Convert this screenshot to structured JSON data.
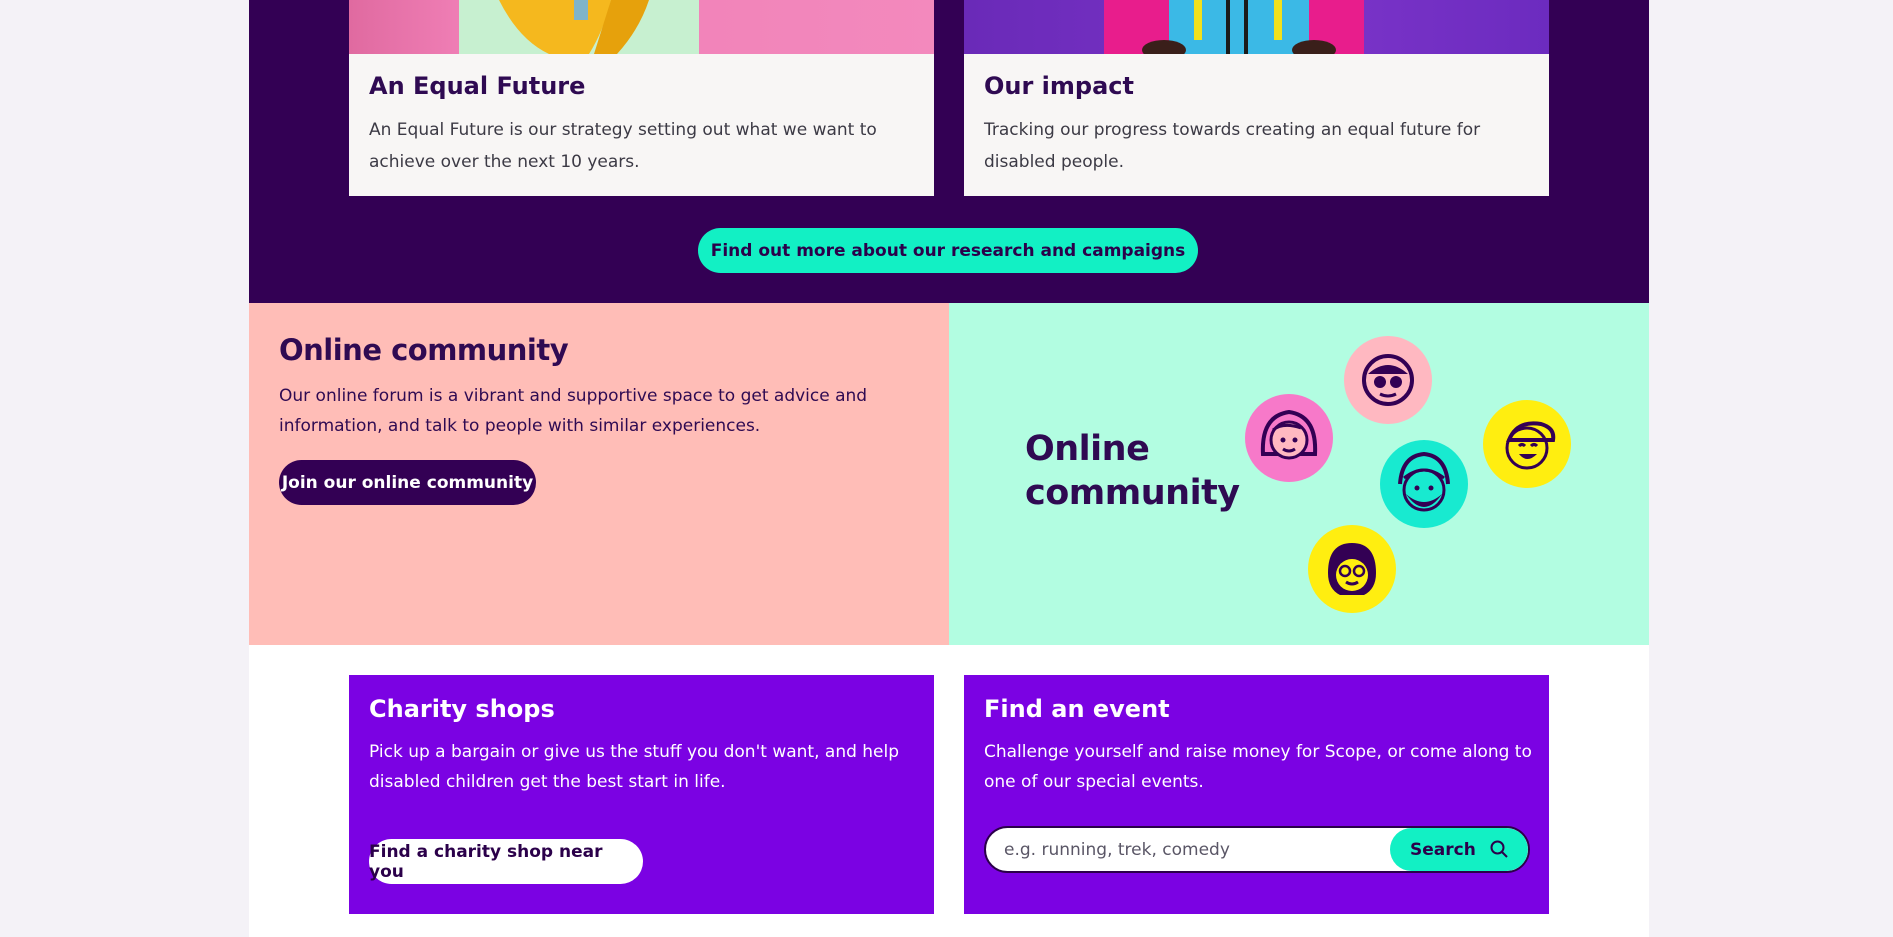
{
  "research": {
    "cards": [
      {
        "title": "An Equal Future",
        "text": "An Equal Future is our strategy setting out what we want to achieve over the next 10 years."
      },
      {
        "title": "Our impact",
        "text": "Tracking our progress towards creating an equal future for disabled people."
      }
    ],
    "button_label": "Find out more about our research and campaigns"
  },
  "community": {
    "title": "Online community",
    "text": "Our online forum is a vibrant and supportive space to get advice and information, and talk to people with similar experiences.",
    "button_label": "Join our online community",
    "illustration_title": "Online community",
    "faces": [
      {
        "name": "glasses-face",
        "color": "#ffb8c1"
      },
      {
        "name": "girl-face",
        "color": "#f779c9"
      },
      {
        "name": "turban-face",
        "color": "#18ead0"
      },
      {
        "name": "cap-face",
        "color": "#ffee10"
      },
      {
        "name": "glasses-girl-face",
        "color": "#ffee10"
      }
    ]
  },
  "shops": {
    "title": "Charity shops",
    "text": "Pick up a bargain or give us the stuff you don't want, and help disabled children get the best start in life.",
    "button_label": "Find a charity shop near you"
  },
  "events": {
    "title": "Find an event",
    "text": "Challenge yourself and raise money for Scope, or come along to one of our special events.",
    "search_placeholder": "e.g. running, trek, comedy",
    "search_value": "",
    "search_button_label": "Search"
  },
  "colors": {
    "dark_purple": "#330054",
    "mint": "#12f0c4",
    "peach": "#ffbdb7",
    "light_mint": "#b2fde1",
    "violet": "#7b02e3"
  }
}
